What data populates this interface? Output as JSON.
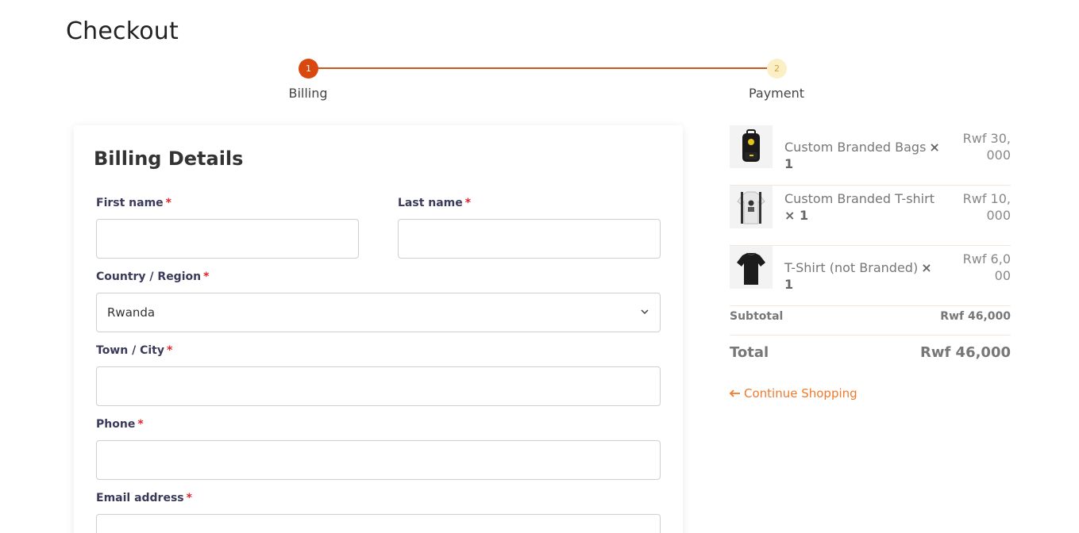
{
  "page": {
    "title": "Checkout"
  },
  "stepper": {
    "steps": [
      {
        "number": "1",
        "label": "Billing",
        "state": "active"
      },
      {
        "number": "2",
        "label": "Payment",
        "state": "pending"
      }
    ],
    "colors": {
      "active": "#d9480f",
      "pending": "#fbefc6",
      "line": "#c95a1e"
    }
  },
  "billing": {
    "title": "Billing Details",
    "required_mark": "*",
    "fields": {
      "first_name": {
        "label": "First name",
        "value": ""
      },
      "last_name": {
        "label": "Last name",
        "value": ""
      },
      "country": {
        "label": "Country / Region",
        "value": "Rwanda"
      },
      "city": {
        "label": "Town / City",
        "value": ""
      },
      "phone": {
        "label": "Phone",
        "value": ""
      },
      "email": {
        "label": "Email address",
        "value": ""
      }
    }
  },
  "summary": {
    "items": [
      {
        "name": "Custom Branded Bags",
        "qty": "× 1",
        "price": "Rwf 30,000",
        "icon": "backpack-icon"
      },
      {
        "name": "Custom Branded T-shirt",
        "qty": "× 1",
        "price": "Rwf 10,000",
        "icon": "tshirt-icon"
      },
      {
        "name": "T-Shirt (not Branded)",
        "qty": "× 1",
        "price": "Rwf 6,000",
        "icon": "tshirt-icon"
      }
    ],
    "subtotal_label": "Subtotal",
    "subtotal_value": "Rwf 46,000",
    "total_label": "Total",
    "total_value": "Rwf 46,000",
    "continue_label": "Continue Shopping",
    "continue_icon": "arrow-left-icon",
    "accent_color": "#f07a2a"
  }
}
